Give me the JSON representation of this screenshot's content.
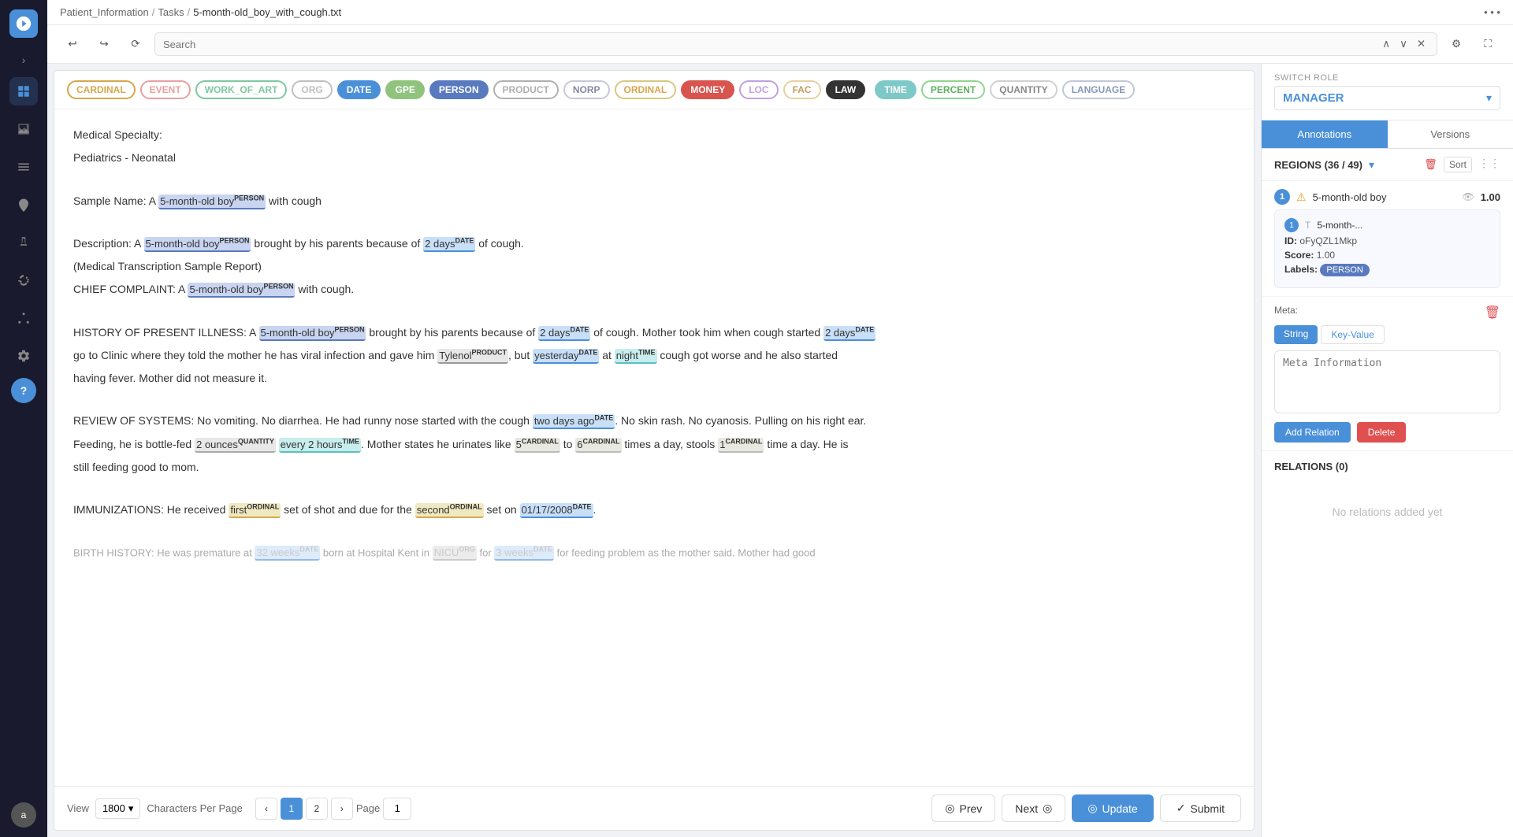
{
  "sidebar": {
    "logo_text": "U",
    "items": [
      {
        "id": "dashboard",
        "icon": "⊞",
        "active": true
      },
      {
        "id": "chart",
        "icon": "📊"
      },
      {
        "id": "list",
        "icon": "☰"
      },
      {
        "id": "map",
        "icon": "◎"
      },
      {
        "id": "lab",
        "icon": "⚗"
      },
      {
        "id": "tools",
        "icon": "✂"
      },
      {
        "id": "network",
        "icon": "⋯"
      },
      {
        "id": "settings",
        "icon": "⚙"
      }
    ],
    "help_label": "?",
    "avatar_label": "a"
  },
  "breadcrumb": {
    "parts": [
      "Patient_Information",
      "Tasks",
      "5-month-old_boy_with_cough.txt"
    ],
    "dots": "⋯"
  },
  "toolbar": {
    "undo_label": "↩",
    "redo_label": "↪",
    "refresh_label": "⟳",
    "search_placeholder": "Search",
    "prev_label": "∧",
    "next_label": "∨",
    "close_label": "✕",
    "gear_label": "⚙",
    "expand_label": "⛶"
  },
  "tags": [
    {
      "id": "cardinal",
      "label": "CARDINAL",
      "class": "tag-cardinal"
    },
    {
      "id": "event",
      "label": "EVENT",
      "class": "tag-event"
    },
    {
      "id": "work_of_art",
      "label": "WORK_OF_ART",
      "class": "tag-work_of_art"
    },
    {
      "id": "org",
      "label": "ORG",
      "class": "tag-org"
    },
    {
      "id": "date",
      "label": "DATE",
      "class": "tag-date"
    },
    {
      "id": "gpe",
      "label": "GPE",
      "class": "tag-gpe"
    },
    {
      "id": "person",
      "label": "PERSON",
      "class": "tag-person"
    },
    {
      "id": "product",
      "label": "PRODUCT",
      "class": "tag-product"
    },
    {
      "id": "norp",
      "label": "NORP",
      "class": "tag-norp"
    },
    {
      "id": "ordinal",
      "label": "ORDINAL",
      "class": "tag-ordinal"
    },
    {
      "id": "money",
      "label": "MONEY",
      "class": "tag-money"
    },
    {
      "id": "loc",
      "label": "LOC",
      "class": "tag-loc"
    },
    {
      "id": "fac",
      "label": "FAC",
      "class": "tag-fac"
    },
    {
      "id": "law",
      "label": "LAW",
      "class": "tag-law"
    },
    {
      "id": "time",
      "label": "TIME",
      "class": "tag-time"
    },
    {
      "id": "percent",
      "label": "PERCENT",
      "class": "tag-percent"
    },
    {
      "id": "quantity",
      "label": "QUANTITY",
      "class": "tag-quantity"
    },
    {
      "id": "language",
      "label": "LANGUAGE",
      "class": "tag-language"
    }
  ],
  "document": {
    "specialty_label": "Medical Specialty:",
    "specialty_value": "Pediatrics - Neonatal",
    "sample_label": "Sample Name:",
    "description_label": "Description:",
    "chief_label": "CHIEF COMPLAINT:",
    "history_label": "HISTORY OF PRESENT ILLNESS:",
    "review_label": "REVIEW OF SYSTEMS:",
    "immunizations_label": "IMMUNIZATIONS:",
    "birth_label": "BIRTH HISTORY:"
  },
  "footer": {
    "view_label": "View",
    "chars_value": "1800",
    "chars_label": "Characters Per Page",
    "page_label": "Page",
    "page_current": "1",
    "prev_btn": "Prev",
    "next_btn": "Next",
    "update_btn": "Update",
    "submit_btn": "Submit"
  },
  "right_panel": {
    "switch_role_label": "Switch Role",
    "role_name": "MANAGER",
    "tab_annotations": "Annotations",
    "tab_versions": "Versions",
    "regions_label": "REGIONS (36 / 49)",
    "sort_label": "Sort",
    "annotation": {
      "number": "1",
      "warning": "⚠",
      "title": "5-month-old boy",
      "eye_icon": "👁",
      "score": "1.00",
      "detail_num": "1",
      "detail_text": "5-month-...",
      "id_label": "ID:",
      "id_value": "oFyQZL1Mkp",
      "score_label": "Score:",
      "score_value": "1.00",
      "labels_label": "Labels:",
      "label_badge": "PERSON",
      "meta_label": "Meta:",
      "meta_tab_string": "String",
      "meta_tab_keyvalue": "Key-Value",
      "meta_placeholder": "Meta Information",
      "add_relation_btn": "Add Relation",
      "delete_btn": "Delete"
    },
    "relations": {
      "title": "RELATIONS (0)",
      "empty_message": "No relations added yet"
    }
  }
}
